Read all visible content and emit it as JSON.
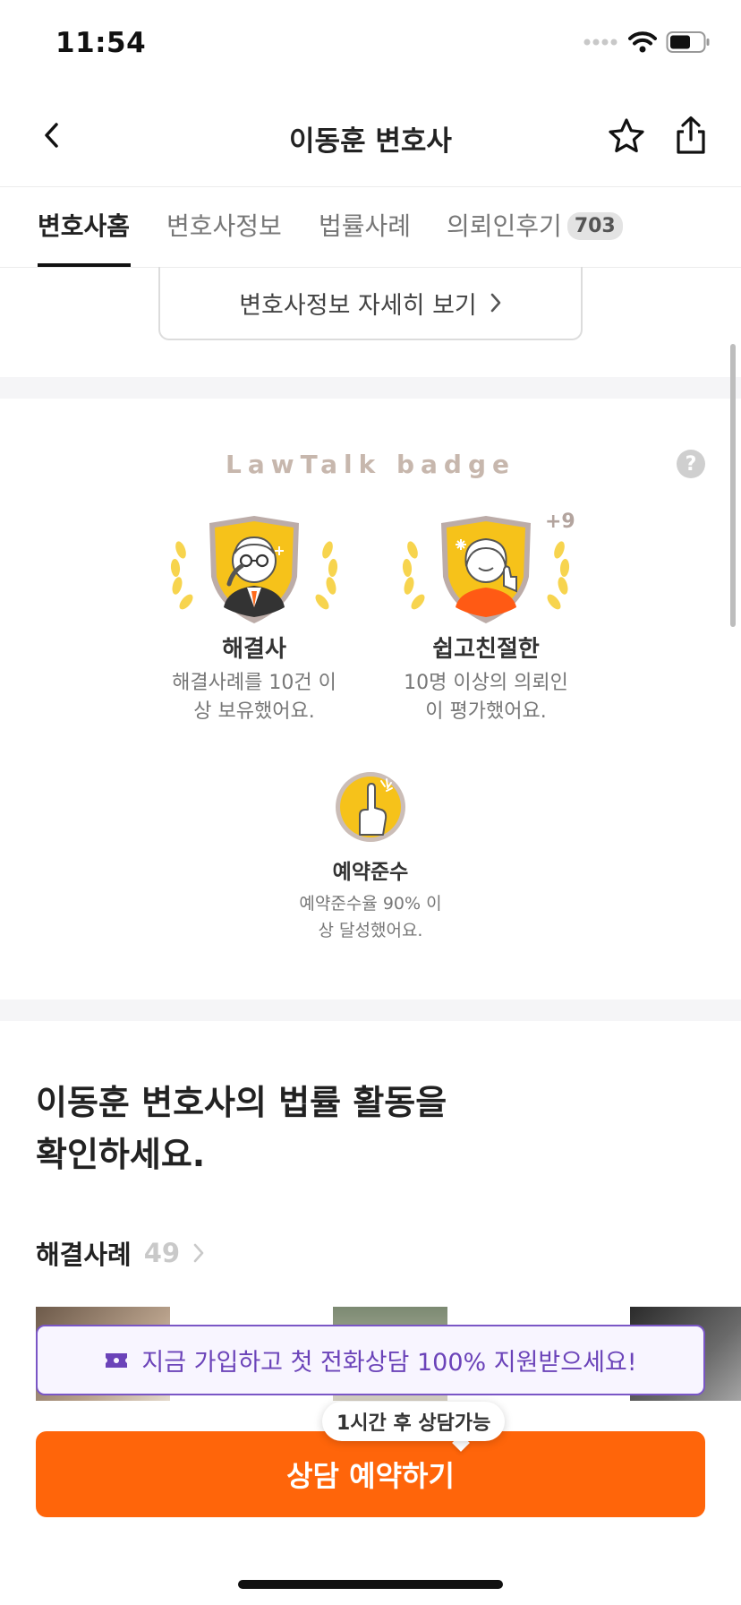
{
  "status_bar": {
    "time": "11:54"
  },
  "nav": {
    "title": "이동훈 변호사"
  },
  "tabs": [
    {
      "label": "변호사홈"
    },
    {
      "label": "변호사정보"
    },
    {
      "label": "법률사례"
    },
    {
      "label": "의뢰인후기",
      "count": "703"
    }
  ],
  "detail_button": {
    "label": "변호사정보 자세히 보기"
  },
  "badges": {
    "title": "LawTalk badge",
    "help": "?",
    "items": [
      {
        "name": "해결사",
        "desc_line1": "해결사례를 10건 이",
        "desc_line2": "상 보유했어요."
      },
      {
        "name": "쉽고친절한",
        "desc_line1": "10명 이상의 의뢰인",
        "desc_line2": "이 평가했어요.",
        "extra": "+9"
      },
      {
        "name": "예약준수",
        "desc_line1": "예약준수율 90% 이",
        "desc_line2": "상 달성했어요."
      }
    ]
  },
  "activity": {
    "headline_line1": "이동훈 변호사의 법률 활동을",
    "headline_line2": "확인하세요.",
    "cases_label": "해결사례",
    "cases_count": "49"
  },
  "promo": {
    "text": "지금 가입하고 첫 전화상담 100% 지원받으세요!",
    "icon": "ticket-icon"
  },
  "cta": {
    "tooltip": "1시간 후 상담가능",
    "label": "상담 예약하기"
  },
  "colors": {
    "accent": "#ff650a",
    "promo": "#6b43b9",
    "badge_gold": "#f6c21a"
  }
}
